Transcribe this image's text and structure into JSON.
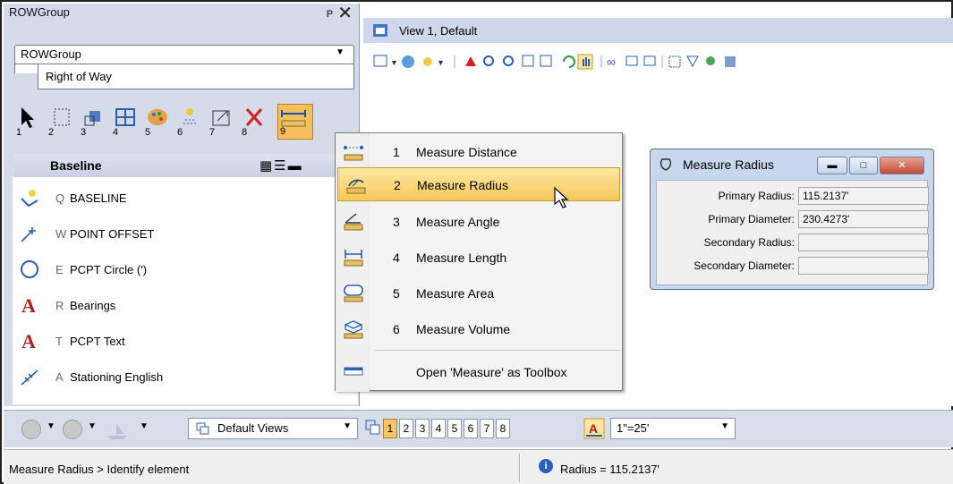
{
  "left_panel": {
    "title": "ROWGroup",
    "pin_glyph": "ᴘ",
    "close_glyph": "✕",
    "group_select": "ROWGroup",
    "group_tab": "Right of Way",
    "tool_numbers": [
      "1",
      "2",
      "3",
      "4",
      "5",
      "6",
      "7",
      "8",
      "9"
    ],
    "baseline_header": "Baseline",
    "tools": [
      {
        "key": "Q",
        "label": "BASELINE",
        "icon": "baseline-icon"
      },
      {
        "key": "W",
        "label": "POINT OFFSET",
        "icon": "point-offset-icon"
      },
      {
        "key": "E",
        "label": "PCPT Circle (')",
        "icon": "circle-icon"
      },
      {
        "key": "R",
        "label": "Bearings",
        "icon": "text-a-icon"
      },
      {
        "key": "T",
        "label": "PCPT Text",
        "icon": "text-a-icon"
      },
      {
        "key": "A",
        "label": "Stationing English",
        "icon": "stationing-icon"
      }
    ]
  },
  "view": {
    "title": "View 1, Default"
  },
  "measure_menu": {
    "items": [
      {
        "num": "1",
        "label": "Measure Distance",
        "icon": "measure-distance-icon"
      },
      {
        "num": "2",
        "label": "Measure Radius",
        "icon": "measure-radius-icon"
      },
      {
        "num": "3",
        "label": "Measure Angle",
        "icon": "measure-angle-icon"
      },
      {
        "num": "4",
        "label": "Measure Length",
        "icon": "measure-length-icon"
      },
      {
        "num": "5",
        "label": "Measure Area",
        "icon": "measure-area-icon"
      },
      {
        "num": "6",
        "label": "Measure Volume",
        "icon": "measure-volume-icon"
      }
    ],
    "toolbox_label": "Open 'Measure' as Toolbox",
    "highlighted_index": 1
  },
  "dialog": {
    "title": "Measure Radius",
    "fields": [
      {
        "label": "Primary Radius:",
        "value": "115.2137'"
      },
      {
        "label": "Primary Diameter:",
        "value": "230.4273'"
      },
      {
        "label": "Secondary Radius:",
        "value": ""
      },
      {
        "label": "Secondary Diameter:",
        "value": ""
      }
    ]
  },
  "bottom_bar": {
    "views_combo": "Default Views",
    "view_numbers": [
      "1",
      "2",
      "3",
      "4",
      "5",
      "6",
      "7",
      "8"
    ],
    "active_view": "1",
    "scale": "1\"=25'"
  },
  "status": {
    "prompt": "Measure Radius > Identify element",
    "result": "Radius = 115.2137'"
  },
  "colors": {
    "panel_bg": "#d6dbe9",
    "highlight": "#f6c85a",
    "dialog_bg": "#c9d7ec"
  }
}
